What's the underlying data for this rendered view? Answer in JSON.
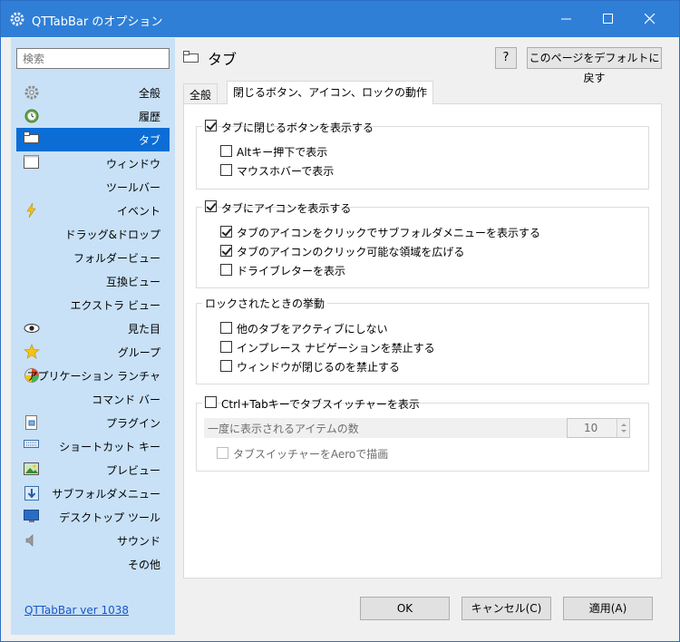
{
  "window": {
    "title": "QTTabBar のオプション"
  },
  "sidebar": {
    "search_placeholder": "検索",
    "items": [
      {
        "label": "全般",
        "icon": "gear-icon"
      },
      {
        "label": "履歴",
        "icon": "history-icon"
      },
      {
        "label": "タブ",
        "icon": "tab-icon",
        "selected": true
      },
      {
        "label": "ウィンドウ",
        "icon": "window-icon"
      },
      {
        "label": "ツールバー",
        "icon": ""
      },
      {
        "label": "イベント",
        "icon": "lightning-icon"
      },
      {
        "label": "ドラッグ&ドロップ",
        "icon": ""
      },
      {
        "label": "フォルダービュー",
        "icon": ""
      },
      {
        "label": "互換ビュー",
        "icon": ""
      },
      {
        "label": "エクストラ ビュー",
        "icon": ""
      },
      {
        "label": "見た目",
        "icon": "eye-icon"
      },
      {
        "label": "グループ",
        "icon": "star-icon"
      },
      {
        "label": "アプリケーション ランチャ",
        "icon": "launcher-icon"
      },
      {
        "label": "コマンド バー",
        "icon": ""
      },
      {
        "label": "プラグイン",
        "icon": "plugin-icon"
      },
      {
        "label": "ショートカット キー",
        "icon": "keyboard-icon"
      },
      {
        "label": "プレビュー",
        "icon": "preview-icon"
      },
      {
        "label": "サブフォルダメニュー",
        "icon": "subfolder-icon"
      },
      {
        "label": "デスクトップ ツール",
        "icon": "desktop-icon"
      },
      {
        "label": "サウンド",
        "icon": "speaker-icon"
      },
      {
        "label": "その他",
        "icon": ""
      }
    ],
    "version_link": "QTTabBar ver 1038"
  },
  "main": {
    "page_title": "タブ",
    "help_label": "?",
    "reset_label": "このページをデフォルトに戻す",
    "tabs": [
      {
        "label": "全般",
        "active": false
      },
      {
        "label": "閉じるボタン、アイコン、ロックの動作",
        "active": true
      }
    ],
    "groups": {
      "close_button": {
        "header": "タブに閉じるボタンを表示する",
        "checked": true,
        "options": [
          {
            "label": "Altキー押下で表示",
            "checked": false
          },
          {
            "label": "マウスホバーで表示",
            "checked": false
          }
        ]
      },
      "icon": {
        "header": "タブにアイコンを表示する",
        "checked": true,
        "options": [
          {
            "label": "タブのアイコンをクリックでサブフォルダメニューを表示する",
            "checked": true
          },
          {
            "label": "タブのアイコンのクリック可能な領域を広げる",
            "checked": true
          },
          {
            "label": "ドライブレターを表示",
            "checked": false
          }
        ]
      },
      "locked": {
        "header": "ロックされたときの挙動",
        "options": [
          {
            "label": "他のタブをアクティブにしない",
            "checked": false
          },
          {
            "label": "インプレース ナビゲーションを禁止する",
            "checked": false
          },
          {
            "label": "ウィンドウが閉じるのを禁止する",
            "checked": false
          }
        ]
      },
      "switcher": {
        "header": "Ctrl+Tabキーでタブスイッチャーを表示",
        "checked": false,
        "count_label": "一度に表示されるアイテムの数",
        "count_value": "10",
        "aero_label": "タブスイッチャーをAeroで描画",
        "aero_checked": false
      }
    }
  },
  "buttons": {
    "ok": "OK",
    "cancel": "キャンセル(C)",
    "apply": "適用(A)"
  },
  "colors": {
    "titlebar": "#2f7fd7",
    "sidebar_bg": "#c8e1f7",
    "selected": "#0b6dd5",
    "link": "#1a56c7"
  }
}
